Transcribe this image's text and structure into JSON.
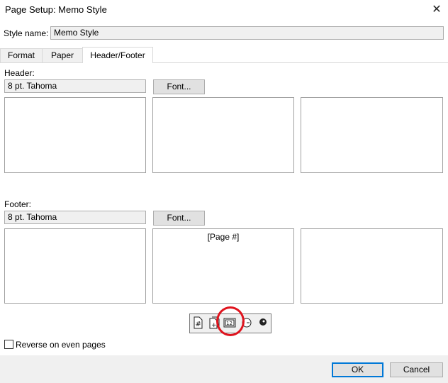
{
  "window": {
    "title": "Page Setup: Memo Style",
    "close_label": "✕"
  },
  "style_name": {
    "label": "Style name:",
    "label_accel": "n",
    "value": "Memo Style"
  },
  "tabs": [
    {
      "label": "Format"
    },
    {
      "label": "Paper"
    },
    {
      "label": "Header/Footer",
      "active": true
    }
  ],
  "header": {
    "label": "Header:",
    "font_value": "8 pt. Tahoma",
    "font_button": "Font...",
    "boxes": [
      "",
      "",
      ""
    ]
  },
  "footer": {
    "label": "Footer:",
    "font_value": "8 pt. Tahoma",
    "font_button": "Font...",
    "boxes": [
      "",
      "[Page #]",
      ""
    ]
  },
  "toolbar": {
    "icons": [
      "page-number-icon",
      "total-pages-icon",
      "date-icon",
      "time-icon",
      "user-name-icon"
    ]
  },
  "reverse_on_even_pages": {
    "label": "Reverse on even pages",
    "checked": false
  },
  "buttons": {
    "ok": "OK",
    "cancel": "Cancel"
  },
  "colors": {
    "highlight_circle": "#e0141e",
    "focus_border": "#0078d7"
  }
}
